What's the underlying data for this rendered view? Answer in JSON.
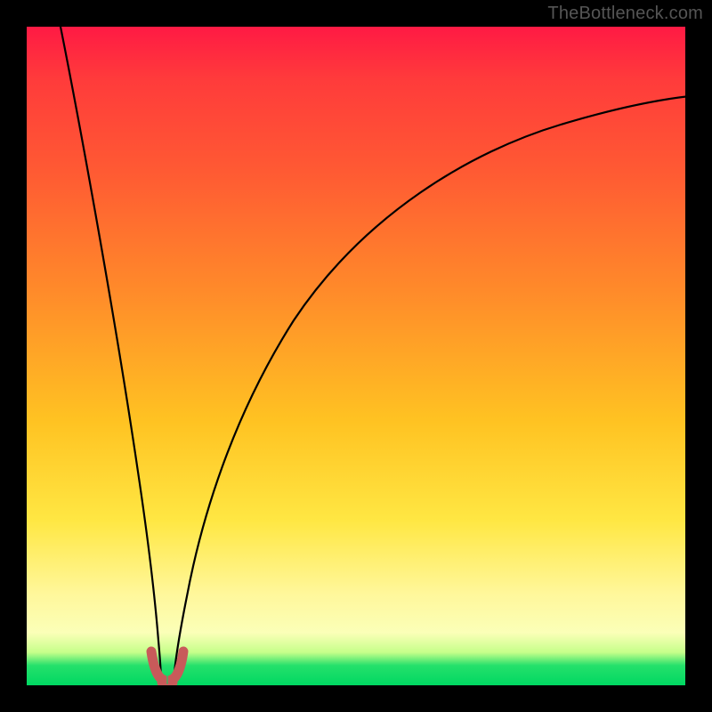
{
  "watermark": "TheBottleneck.com",
  "chart_data": {
    "type": "line",
    "title": "",
    "xlabel": "",
    "ylabel": "",
    "xlim": [
      0,
      100
    ],
    "ylim": [
      0,
      100
    ],
    "grid": false,
    "legend": false,
    "background_gradient": "red-to-green-vertical",
    "series": [
      {
        "name": "left-branch",
        "color": "#000000",
        "x": [
          5,
          8,
          11,
          14,
          16,
          17.5,
          18.3,
          18.8,
          19.2,
          19.5
        ],
        "y": [
          100,
          80,
          58,
          36,
          18,
          8,
          3,
          1,
          0.4,
          0.2
        ]
      },
      {
        "name": "right-branch",
        "color": "#000000",
        "x": [
          21.5,
          22,
          23,
          25,
          28,
          33,
          40,
          50,
          62,
          75,
          88,
          100
        ],
        "y": [
          0.2,
          1,
          5,
          14,
          28,
          44,
          58,
          70,
          78.5,
          84,
          87.5,
          90
        ]
      },
      {
        "name": "bottom-bump",
        "color": "#cf5a5a",
        "x": [
          18.5,
          19.0,
          19.5,
          20.0,
          20.5,
          21.0,
          21.5,
          22.0,
          22.5
        ],
        "y": [
          4.5,
          2.5,
          1.3,
          1.0,
          1.0,
          1.3,
          2.5,
          4.5,
          4.5
        ]
      }
    ]
  }
}
